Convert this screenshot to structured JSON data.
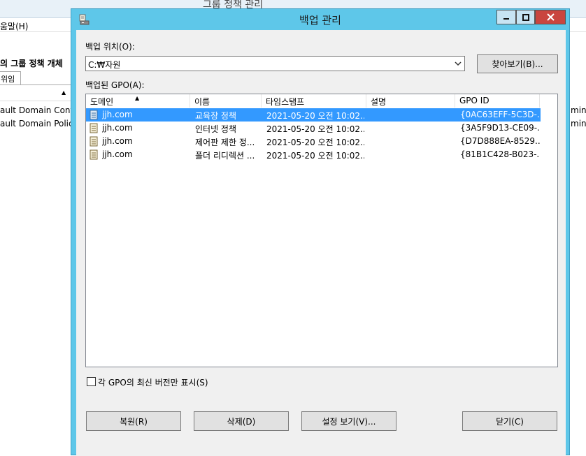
{
  "background_window": {
    "title": "그룹 정책 관리",
    "menu_help": "움말(H)",
    "pane_title": "의 그룹 정책 개체",
    "tab_label": "위임",
    "rows": [
      "ault Domain Contro",
      "ault Domain Policy"
    ],
    "right_texts": [
      "mins",
      "mins"
    ]
  },
  "dialog": {
    "title": "백업 관리",
    "window_controls": {
      "minimize": "—",
      "maximize": "□",
      "close": "✕"
    },
    "backup_location_label": "백업 위치(O):",
    "backup_location_value": "C:₩자원",
    "browse_button": "찾아보기(B)...",
    "backed_up_gpo_label": "백업된 GPO(A):",
    "columns": [
      "도메인",
      "이름",
      "타임스탬프",
      "설명",
      "GPO ID"
    ],
    "rows": [
      {
        "domain": "jjh.com",
        "name": "교육장 정책",
        "timestamp": "2021-05-20 오전 10:02...",
        "description": "",
        "gpo_id": "{0AC63EFF-5C3D-...",
        "selected": true
      },
      {
        "domain": "jjh.com",
        "name": "인터넷 정책",
        "timestamp": "2021-05-20 오전 10:02...",
        "description": "",
        "gpo_id": "{3A5F9D13-CE09-...",
        "selected": false
      },
      {
        "domain": "jjh.com",
        "name": "제어판 제한 정...",
        "timestamp": "2021-05-20 오전 10:02...",
        "description": "",
        "gpo_id": "{D7D888EA-8529...",
        "selected": false
      },
      {
        "domain": "jjh.com",
        "name": "폴더 리디렉션 ...",
        "timestamp": "2021-05-20 오전 10:02...",
        "description": "",
        "gpo_id": "{81B1C428-B023-...",
        "selected": false
      }
    ],
    "latest_only_checkbox": {
      "label": "각 GPO의 최신 버전만 표시(S)",
      "checked": false
    },
    "buttons": {
      "restore": "복원(R)",
      "delete": "삭제(D)",
      "view_settings": "설정 보기(V)...",
      "close": "닫기(C)"
    },
    "colors": {
      "title_bar": "#5ec7e9",
      "selection": "#3399ff",
      "close_button": "#c9453f"
    }
  }
}
